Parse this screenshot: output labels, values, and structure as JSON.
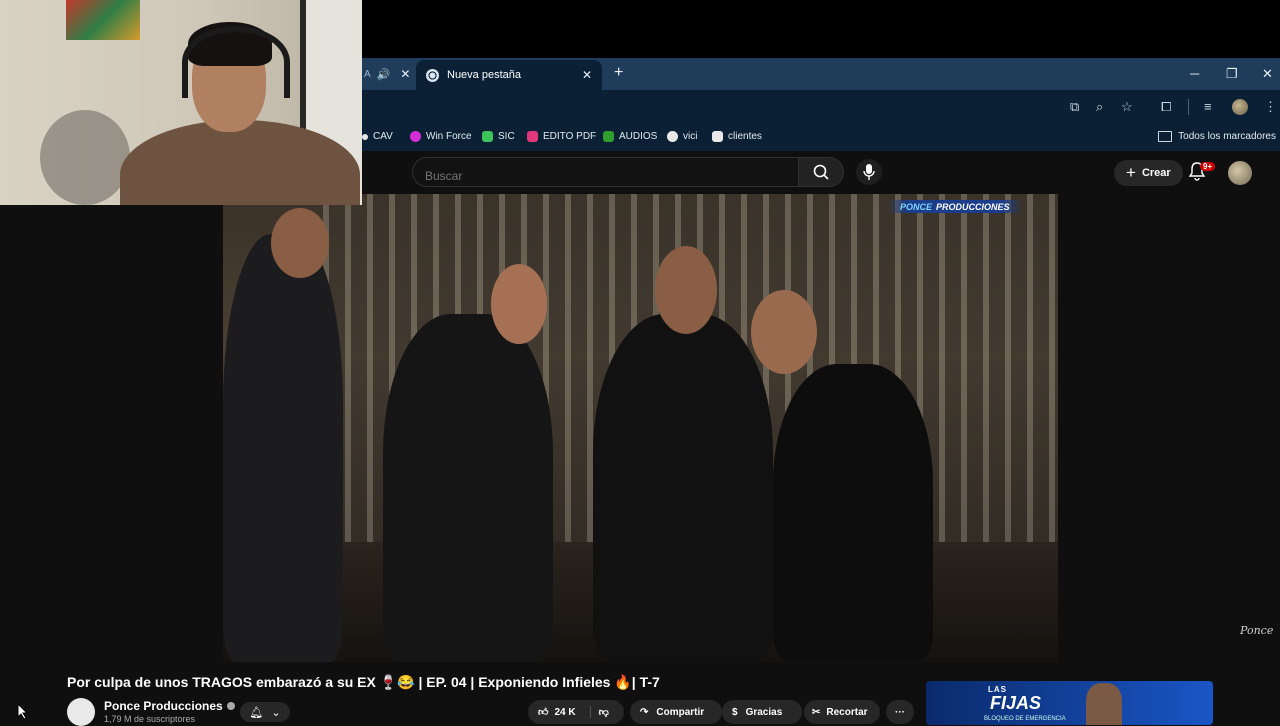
{
  "browser": {
    "active_tab_title": "Nueva pestaña",
    "new_tab_glyph": "+",
    "bookmarks": [
      {
        "label": "CAV",
        "color": "#e8e8e8"
      },
      {
        "label": "Win Force",
        "color": "#d42fd4"
      },
      {
        "label": "SIC",
        "color": "#3cc35a"
      },
      {
        "label": "EDITO PDF",
        "color": "#e0387a"
      },
      {
        "label": "AUDIOS",
        "color": "#2f9e2f"
      },
      {
        "label": "vici",
        "color": "#e8e8e8"
      },
      {
        "label": "clientes",
        "color": "#e8e8e8"
      }
    ],
    "all_bookmarks_label": "Todos los marcadores"
  },
  "youtube": {
    "search_placeholder": "Buscar",
    "create_label": "Crear",
    "notifications_badge": "9+",
    "video": {
      "watermark": {
        "part1": "PONCE",
        "part2": "PRODUCCIONES"
      },
      "signature": "Ponce",
      "title": "Por culpa de unos TRAGOS embarazó a su EX 🍷😂 | EP. 04 | Exponiendo Infieles 🔥| T-7",
      "channel_name": "Ponce Producciones",
      "subscribers": "1,79 M de suscriptores",
      "likes": "24 K",
      "share_label": "Compartir",
      "thanks_label": "Gracias",
      "clip_label": "Recortar",
      "more_label": "···"
    },
    "ad": {
      "line1": "LAS",
      "line2": "FIJAS",
      "line3": "BLOQUEO DE EMERGENCIA"
    }
  }
}
